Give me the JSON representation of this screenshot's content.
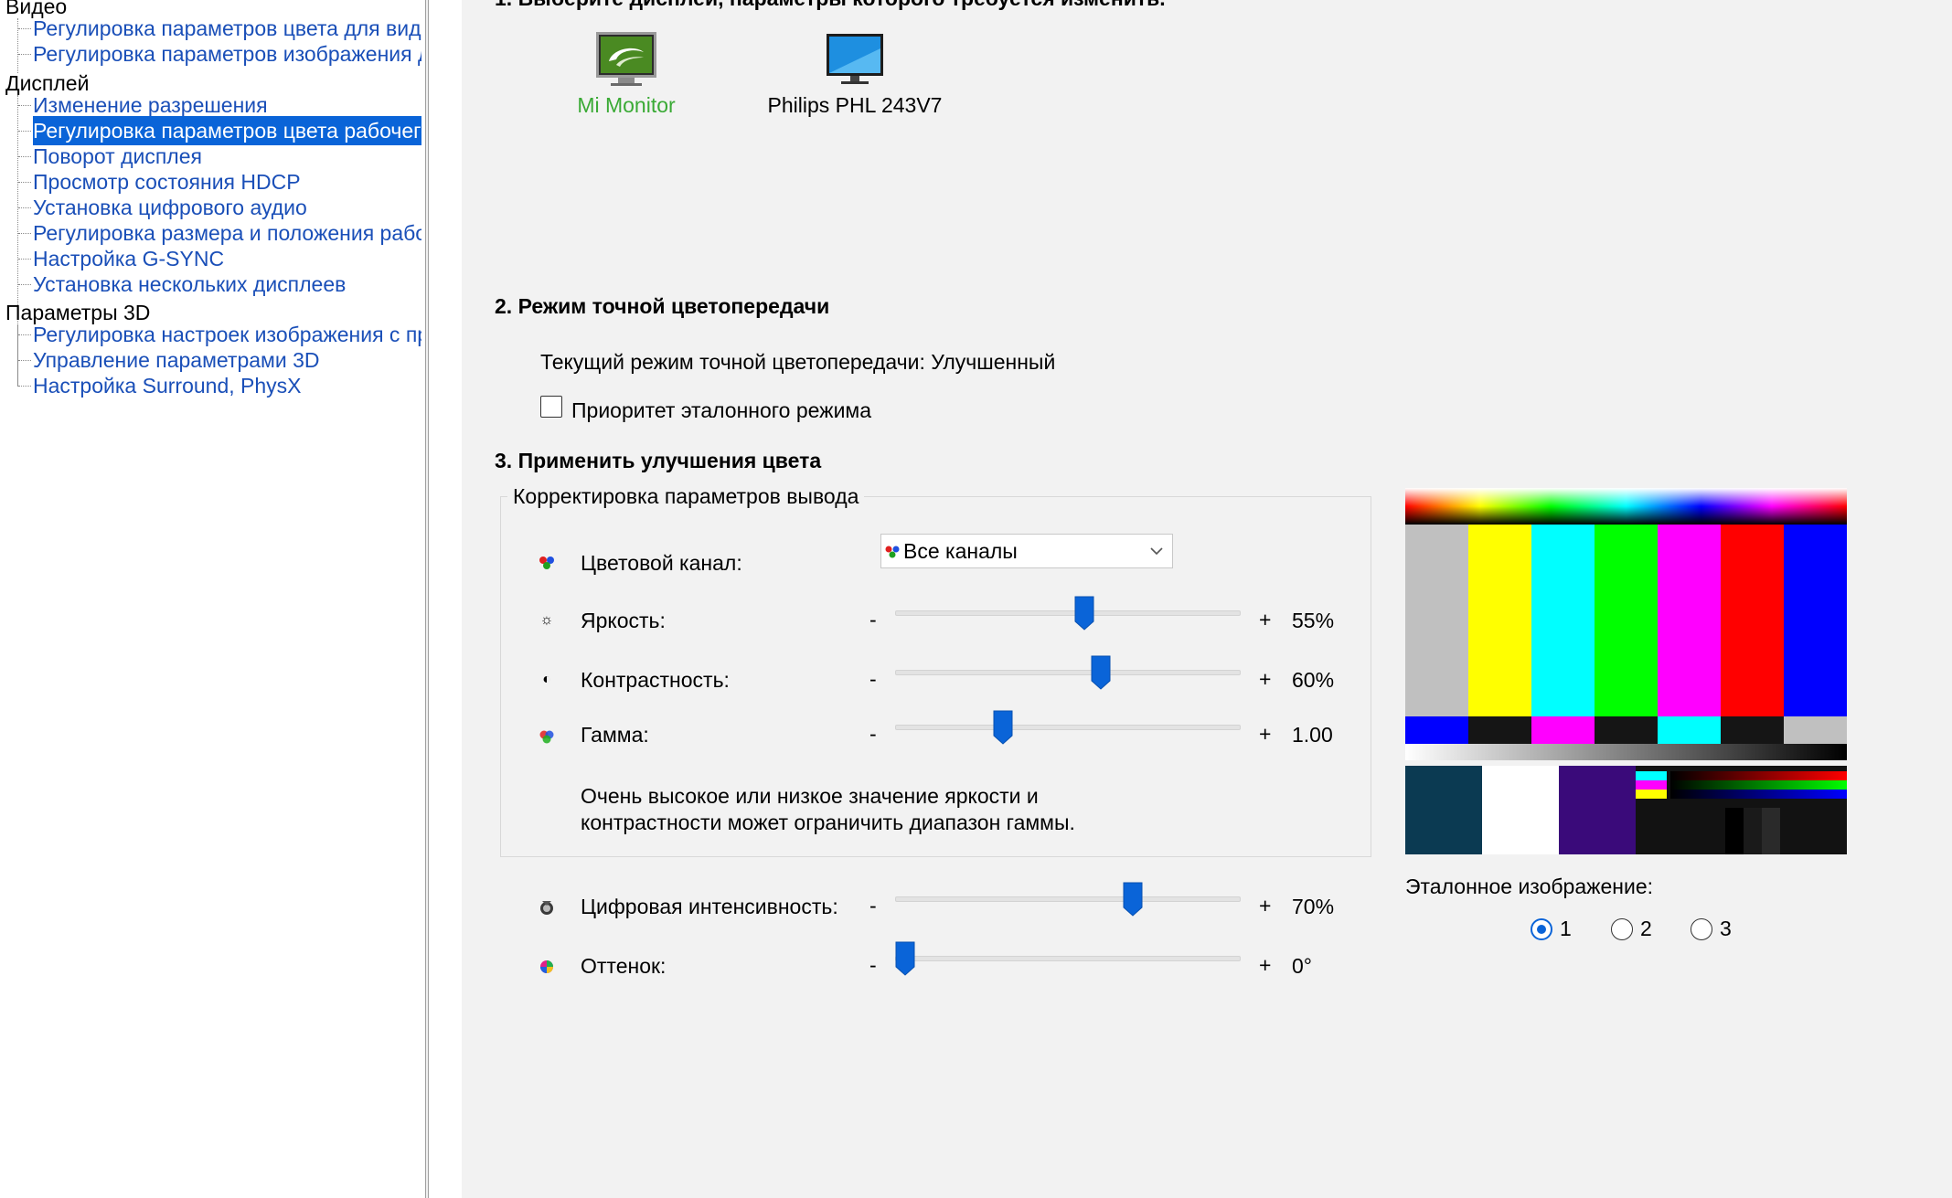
{
  "sidebar": {
    "groups": [
      {
        "label": "Видео",
        "items": [
          "Регулировка параметров цвета для видео",
          "Регулировка параметров изображения для видео"
        ]
      },
      {
        "label": "Дисплей",
        "items": [
          "Изменение разрешения",
          "Регулировка параметров цвета рабочего стола",
          "Поворот дисплея",
          "Просмотр состояния HDCP",
          "Установка цифрового аудио",
          "Регулировка размера и положения рабочего стола",
          "Настройка G-SYNC",
          "Установка нескольких дисплеев"
        ]
      },
      {
        "label": "Параметры 3D",
        "items": [
          "Регулировка настроек изображения с просмотром",
          "Управление параметрами 3D",
          "Настройка Surround, PhysX"
        ]
      }
    ],
    "selected": "Регулировка параметров цвета рабочего стола"
  },
  "section1": {
    "title": "1. Выберите дисплей, параметры которого требуется изменить.",
    "monitors": [
      {
        "name": "Mi Monitor",
        "selected": true,
        "icon": "nvidia-monitor-icon"
      },
      {
        "name": "Philips PHL 243V7",
        "selected": false,
        "icon": "monitor-icon"
      }
    ]
  },
  "section2": {
    "title": "2. Режим точной цветопередачи",
    "current_mode": "Текущий режим точной цветопередачи: Улучшенный",
    "priority_checkbox": {
      "label": "Приоритет эталонного режима",
      "checked": false
    }
  },
  "section3": {
    "title": "3. Применить улучшения цвета",
    "group_label": "Корректировка параметров вывода",
    "channel": {
      "label": "Цветовой канал:",
      "value": "Все каналы"
    },
    "minus": "-",
    "plus": "+",
    "brightness": {
      "label": "Яркость:",
      "value": "55%",
      "level": 0.55
    },
    "contrast": {
      "label": "Контрастность:",
      "value": "60%",
      "level": 0.6
    },
    "gamma": {
      "label": "Гамма:",
      "value": "1.00",
      "level": 0.3
    },
    "warning": [
      "Очень высокое или низкое значение яркости и",
      "контрастности может ограничить диапазон гаммы."
    ],
    "digital_vibrance": {
      "label": "Цифровая интенсивность:",
      "value": "70%",
      "level": 0.7
    },
    "hue": {
      "label": "Оттенок:",
      "value": "0°",
      "level": 0.0
    }
  },
  "reference": {
    "label": "Эталонное изображение:",
    "options": [
      "1",
      "2",
      "3"
    ],
    "selected": "1"
  },
  "colors": {
    "accent": "#0a64d8",
    "link": "#1a4fb8",
    "selected_monitor": "#3aaa35"
  }
}
